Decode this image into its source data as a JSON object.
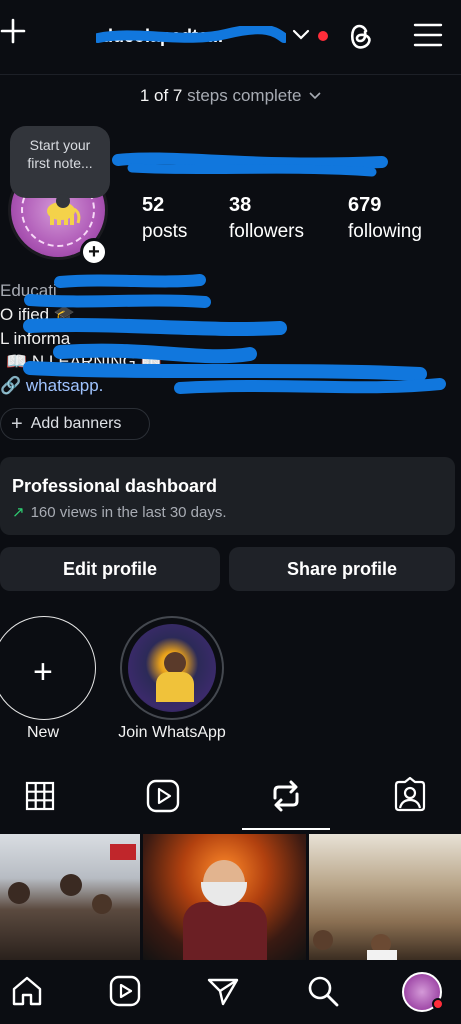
{
  "header": {
    "username": "ducolapadte...",
    "has_notification": true,
    "colors": {
      "background": "#0b0d12",
      "notification_dot": "#ff2d3a",
      "scribble": "#1177dd"
    }
  },
  "steps": {
    "count": "1 of 7",
    "suffix": " steps complete"
  },
  "profile": {
    "note": "Start your first note...",
    "stats": [
      {
        "value": "52",
        "label": "posts"
      },
      {
        "value": "38",
        "label": "followers"
      },
      {
        "value": "679",
        "label": "following"
      }
    ],
    "bio": {
      "line1": "Educati",
      "line2": "O           ified 🎓",
      "line3": "L         informa",
      "line4": "📖                     N LEARNING 📖",
      "link": "🔗 whatsapp."
    }
  },
  "add_banners": {
    "label": "Add banners"
  },
  "dashboard": {
    "title": "Professional dashboard",
    "subtitle": "160 views in the last 30 days."
  },
  "buttons": {
    "edit": "Edit profile",
    "share": "Share profile"
  },
  "highlights": [
    {
      "label": "New"
    },
    {
      "label": "Join WhatsApp"
    }
  ],
  "tabs": [
    "grid-icon",
    "reels-icon",
    "reposts-icon",
    "tagged-icon"
  ],
  "nav": [
    "home-icon",
    "reels-icon",
    "send-icon",
    "search-icon",
    "profile-avatar"
  ]
}
